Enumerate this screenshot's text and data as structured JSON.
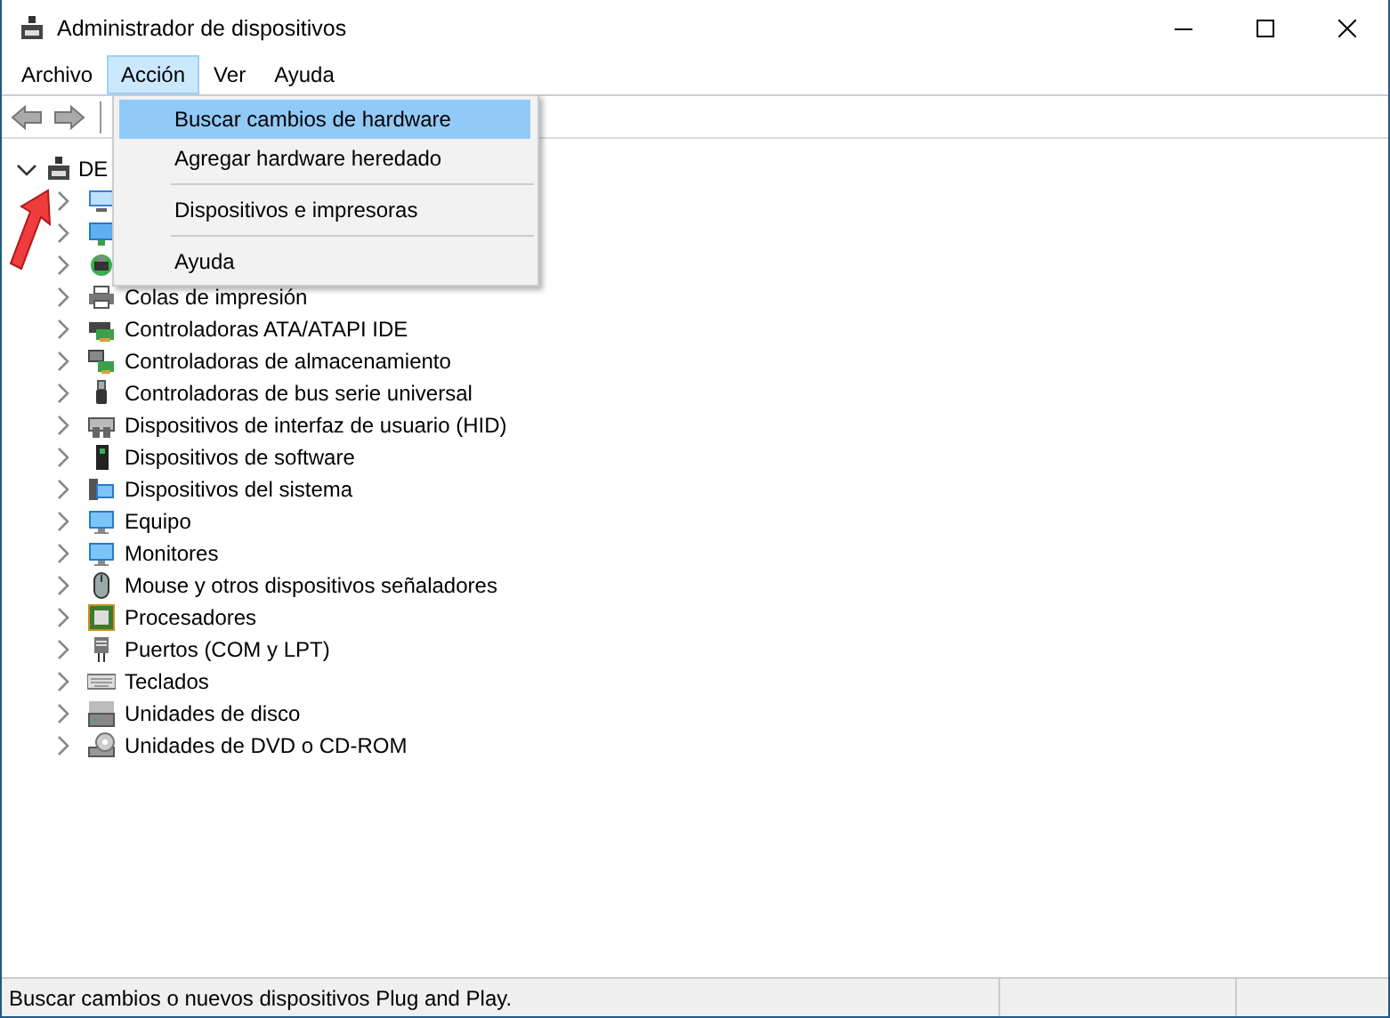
{
  "window": {
    "title": "Administrador de dispositivos"
  },
  "menu_bar": [
    {
      "label": "Archivo",
      "selected": false
    },
    {
      "label": "Acción",
      "selected": true
    },
    {
      "label": "Ver",
      "selected": false
    },
    {
      "label": "Ayuda",
      "selected": false
    }
  ],
  "dropdown": [
    {
      "kind": "item",
      "label": "Buscar cambios de hardware",
      "selected": true
    },
    {
      "kind": "item",
      "label": "Agregar hardware heredado",
      "selected": false
    },
    {
      "kind": "separator"
    },
    {
      "kind": "item",
      "label": "Dispositivos e impresoras",
      "selected": false
    },
    {
      "kind": "separator"
    },
    {
      "kind": "item",
      "label": "Ayuda",
      "selected": false
    }
  ],
  "tree": {
    "label": "DE",
    "expanded": true,
    "children": [
      {
        "expanded": false
      },
      {
        "expanded": false
      },
      {
        "expanded": false
      },
      {
        "label": "Colas de impresión",
        "expanded": false
      },
      {
        "label": "Controladoras ATA/ATAPI IDE",
        "expanded": false
      },
      {
        "label": "Controladoras de almacenamiento",
        "expanded": false
      },
      {
        "label": "Controladoras de bus serie universal",
        "expanded": false
      },
      {
        "label": "Dispositivos de interfaz de usuario (HID)",
        "expanded": false
      },
      {
        "label": "Dispositivos de software",
        "expanded": false
      },
      {
        "label": "Dispositivos del sistema",
        "expanded": false
      },
      {
        "label": "Equipo",
        "expanded": false
      },
      {
        "label": "Monitores",
        "expanded": false
      },
      {
        "label": "Mouse y otros dispositivos señaladores",
        "expanded": false
      },
      {
        "label": "Procesadores",
        "expanded": false
      },
      {
        "label": "Puertos (COM y LPT)",
        "expanded": false
      },
      {
        "label": "Teclados",
        "expanded": false
      },
      {
        "label": "Unidades de disco",
        "expanded": false
      },
      {
        "label": "Unidades de DVD o CD-ROM",
        "expanded": false
      }
    ]
  },
  "status_bar": {
    "text": "Buscar cambios o nuevos dispositivos Plug and Play."
  }
}
